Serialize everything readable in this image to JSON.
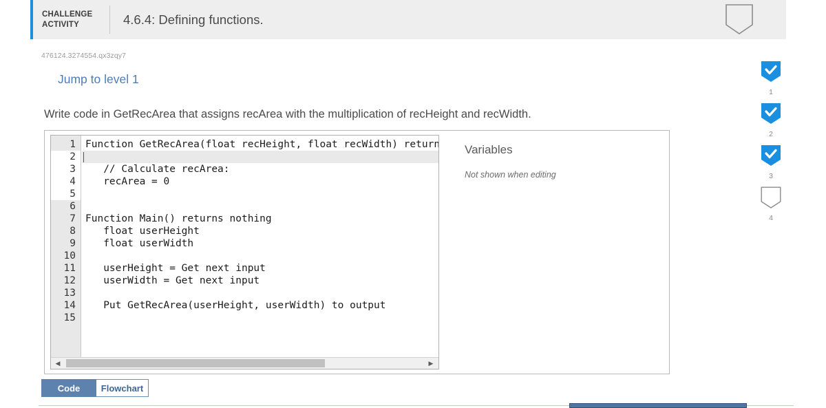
{
  "header": {
    "label": "CHALLENGE ACTIVITY",
    "label_line1": "CHALLENGE",
    "label_line2": "ACTIVITY",
    "title": "4.6.4: Defining functions.",
    "badge_icon": "shield-empty-icon",
    "accent_color": "#1a8fe0",
    "background_color": "#eeeeee"
  },
  "activity": {
    "id": "476124.3274554.qx3zqy7",
    "jump_link": "Jump to level 1",
    "prompt": "Write code in GetRecArea that assigns recArea with the multiplication of recHeight and recWidth."
  },
  "editor": {
    "lines": [
      {
        "number": "1",
        "text": "Function GetRecArea(float recHeight, float recWidth) return",
        "active": false,
        "editable": false
      },
      {
        "number": "2",
        "text": "",
        "active": true,
        "editable": true
      },
      {
        "number": "3",
        "text": "   // Calculate recArea:",
        "active": false,
        "editable": true
      },
      {
        "number": "4",
        "text": "   recArea = 0",
        "active": false,
        "editable": true
      },
      {
        "number": "5",
        "text": "",
        "active": false,
        "editable": true
      },
      {
        "number": "6",
        "text": "",
        "active": false,
        "editable": false
      },
      {
        "number": "7",
        "text": "Function Main() returns nothing",
        "active": false,
        "editable": false
      },
      {
        "number": "8",
        "text": "   float userHeight",
        "active": false,
        "editable": false
      },
      {
        "number": "9",
        "text": "   float userWidth",
        "active": false,
        "editable": false
      },
      {
        "number": "10",
        "text": "",
        "active": false,
        "editable": false
      },
      {
        "number": "11",
        "text": "   userHeight = Get next input",
        "active": false,
        "editable": false
      },
      {
        "number": "12",
        "text": "   userWidth = Get next input",
        "active": false,
        "editable": false
      },
      {
        "number": "13",
        "text": "",
        "active": false,
        "editable": false
      },
      {
        "number": "14",
        "text": "   Put GetRecArea(userHeight, userWidth) to output",
        "active": false,
        "editable": false
      },
      {
        "number": "15",
        "text": "",
        "active": false,
        "editable": false
      }
    ],
    "scrollbar": {
      "left_arrow": "◀",
      "right_arrow": "▶"
    }
  },
  "variables": {
    "title": "Variables",
    "note": "Not shown when editing"
  },
  "tabs": [
    {
      "label": "Code",
      "active": true
    },
    {
      "label": "Flowchart",
      "active": false
    }
  ],
  "progress_rail": {
    "items": [
      {
        "number": "1",
        "state": "complete",
        "icon": "check-icon"
      },
      {
        "number": "2",
        "state": "complete",
        "icon": "check-icon"
      },
      {
        "number": "3",
        "state": "complete",
        "icon": "check-icon"
      },
      {
        "number": "4",
        "state": "empty",
        "icon": "shield-empty-icon"
      }
    ],
    "complete_color": "#1a8fe0",
    "empty_color": "#ffffff"
  }
}
